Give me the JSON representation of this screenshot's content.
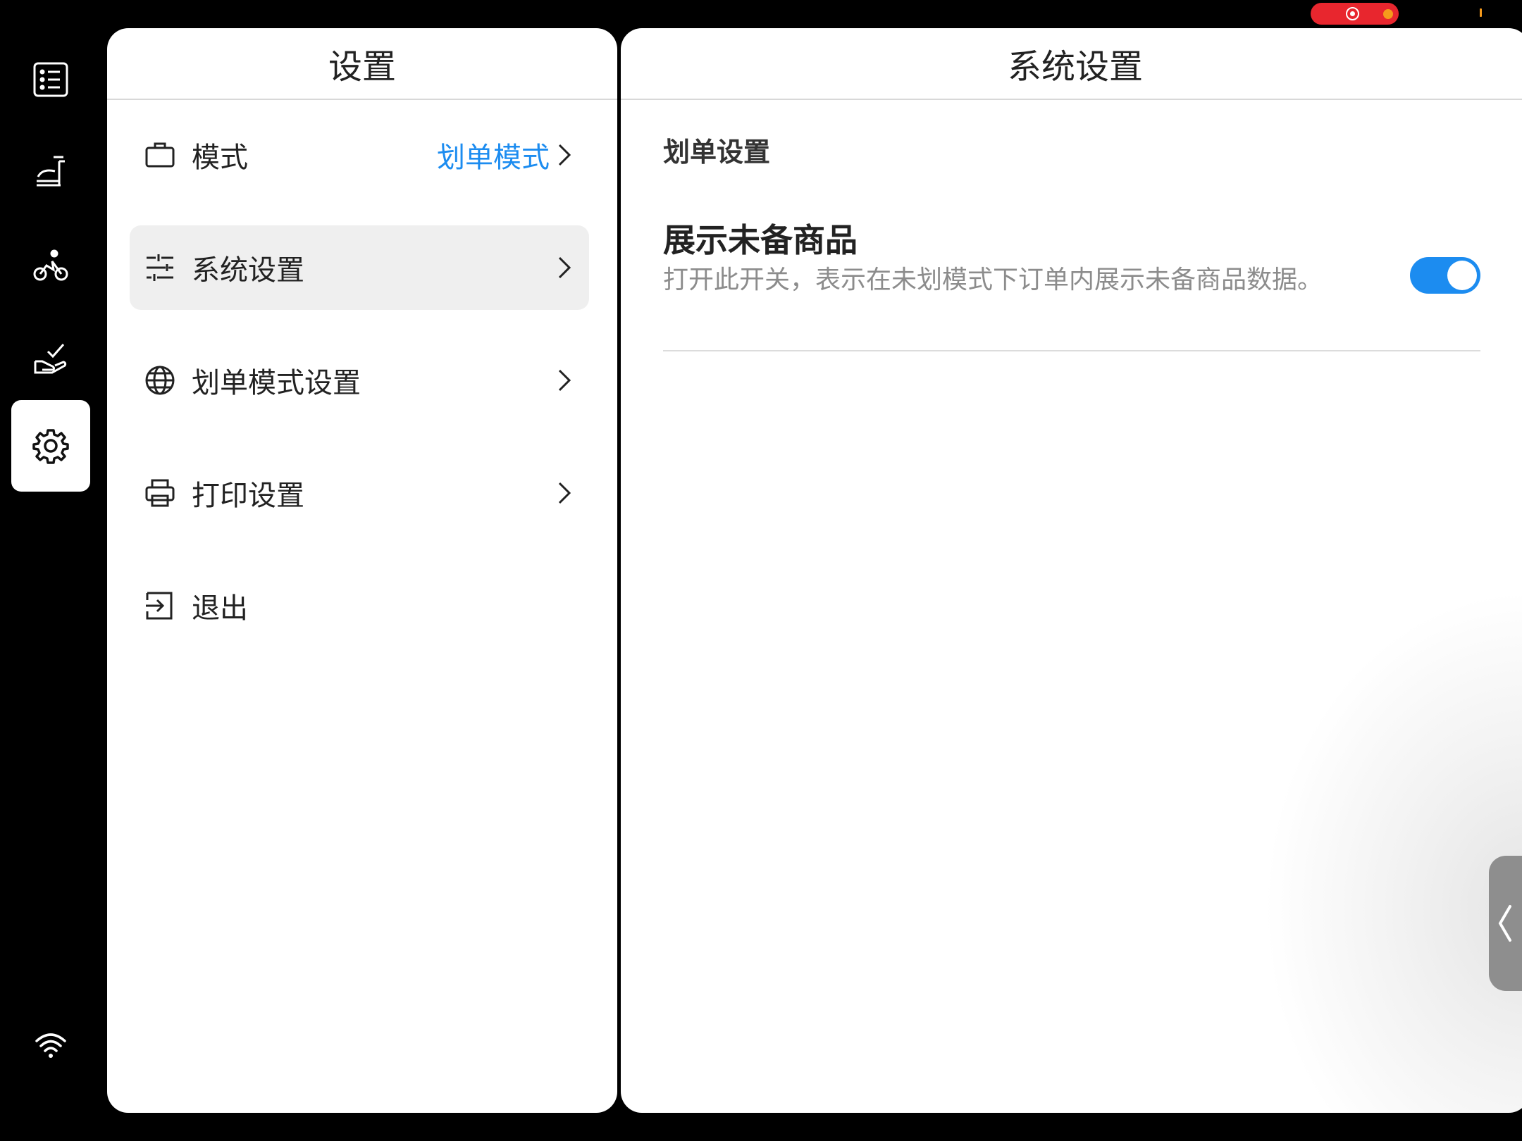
{
  "left_panel": {
    "title": "设置"
  },
  "menu": {
    "mode": {
      "label": "模式",
      "value": "划单模式"
    },
    "system": {
      "label": "系统设置"
    },
    "scan_mode": {
      "label": "划单模式设置"
    },
    "print": {
      "label": "打印设置"
    },
    "logout": {
      "label": "退出"
    }
  },
  "right_panel": {
    "title": "系统设置",
    "section_title": "划单设置",
    "setting": {
      "title": "展示未备商品",
      "description": "打开此开关，表示在未划模式下订单内展示未备商品数据。",
      "enabled": true
    }
  },
  "rail": {
    "items": [
      "list-icon",
      "kitchen-serve-icon",
      "delivery-bike-icon",
      "hand-check-icon",
      "gear-icon"
    ],
    "active": "gear-icon",
    "bottom": "wifi-icon"
  },
  "colors": {
    "accent": "#1c8cf0",
    "record": "#e8262e",
    "indicator": "#f59a1c"
  }
}
